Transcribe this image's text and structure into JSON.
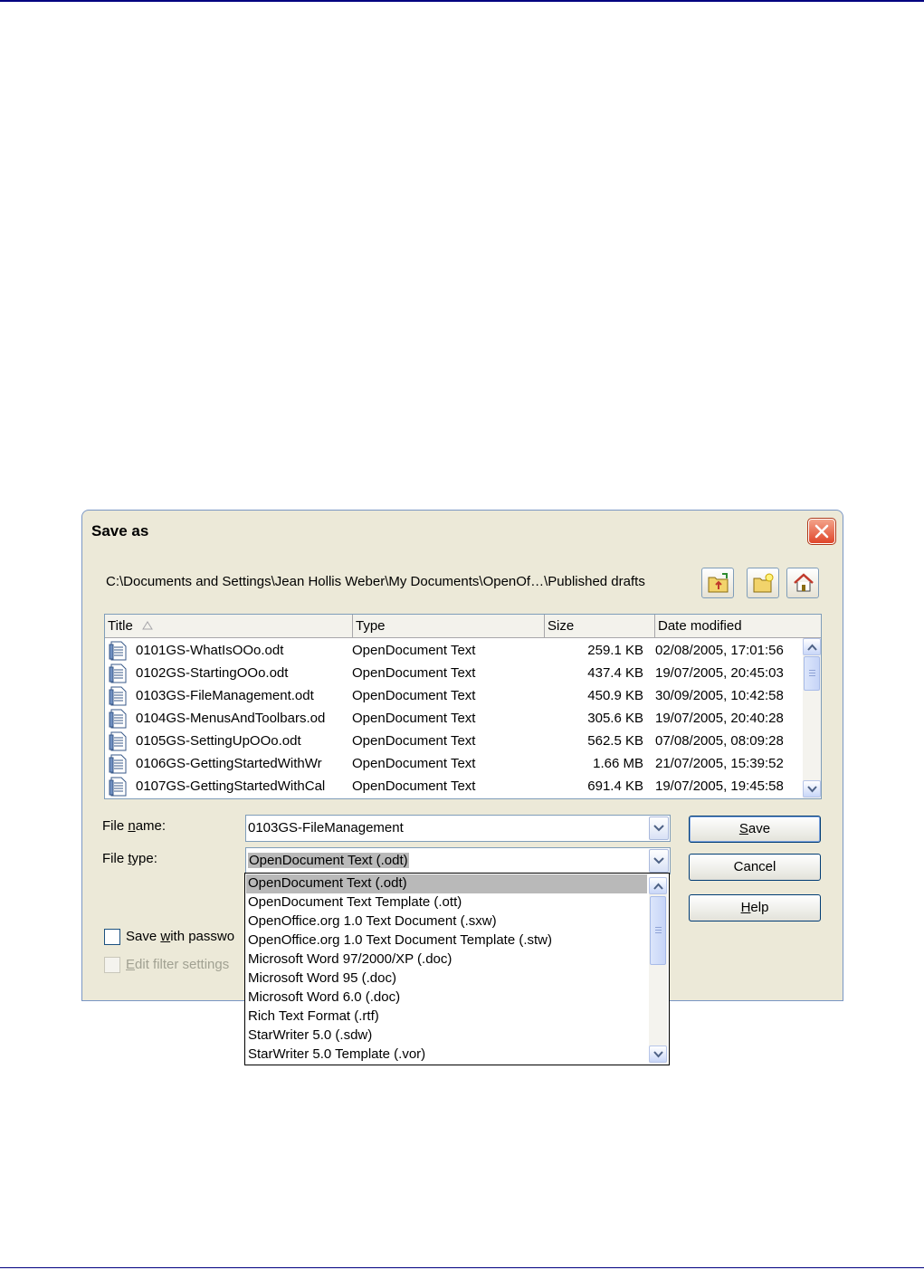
{
  "dialog": {
    "title": "Save as",
    "path": "C:\\Documents and Settings\\Jean Hollis Weber\\My Documents\\OpenOf…\\Published drafts",
    "toolbar": {
      "up_icon": "folder-up-icon",
      "new_folder_icon": "new-folder-icon",
      "home_icon": "home-icon"
    },
    "columns": {
      "title": "Title",
      "type": "Type",
      "size": "Size",
      "date": "Date modified"
    },
    "files": [
      {
        "title": "0101GS-WhatIsOOo.odt",
        "type": "OpenDocument Text",
        "size": "259.1 KB",
        "date": "02/08/2005, 17:01:56"
      },
      {
        "title": "0102GS-StartingOOo.odt",
        "type": "OpenDocument Text",
        "size": "437.4 KB",
        "date": "19/07/2005, 20:45:03"
      },
      {
        "title": "0103GS-FileManagement.odt",
        "type": "OpenDocument Text",
        "size": "450.9 KB",
        "date": "30/09/2005, 10:42:58"
      },
      {
        "title": "0104GS-MenusAndToolbars.od",
        "type": "OpenDocument Text",
        "size": "305.6 KB",
        "date": "19/07/2005, 20:40:28"
      },
      {
        "title": "0105GS-SettingUpOOo.odt",
        "type": "OpenDocument Text",
        "size": "562.5 KB",
        "date": "07/08/2005, 08:09:28"
      },
      {
        "title": "0106GS-GettingStartedWithWr",
        "type": "OpenDocument Text",
        "size": "1.66 MB",
        "date": "21/07/2005, 15:39:52"
      },
      {
        "title": "0107GS-GettingStartedWithCal",
        "type": "OpenDocument Text",
        "size": "691.4 KB",
        "date": "19/07/2005, 19:45:58"
      }
    ],
    "file_name": {
      "label_pre": "File ",
      "label_key": "n",
      "label_post": "ame:",
      "value": "0103GS-FileManagement"
    },
    "file_type": {
      "label_pre": "File ",
      "label_key": "t",
      "label_post": "ype:",
      "value": "OpenDocument Text (.odt)"
    },
    "buttons": {
      "save_key": "S",
      "save_rest": "ave",
      "cancel": "Cancel",
      "help_key": "H",
      "help_rest": "elp"
    },
    "password": {
      "pre": "Save ",
      "key": "w",
      "post": "ith passwo"
    },
    "filter": {
      "key": "E",
      "post": "dit filter settings"
    },
    "file_type_options": [
      "OpenDocument Text (.odt)",
      "OpenDocument Text Template (.ott)",
      "OpenOffice.org 1.0 Text Document (.sxw)",
      "OpenOffice.org 1.0 Text Document Template (.stw)",
      "Microsoft Word 97/2000/XP (.doc)",
      "Microsoft Word 95 (.doc)",
      "Microsoft Word 6.0 (.doc)",
      "Rich Text Format (.rtf)",
      "StarWriter 5.0 (.sdw)",
      "StarWriter 5.0 Template (.vor)"
    ],
    "colors": {
      "title_close": "#e0462b",
      "highlight": "#b9b9b9",
      "dialog_bg": "#ece9d8"
    }
  }
}
